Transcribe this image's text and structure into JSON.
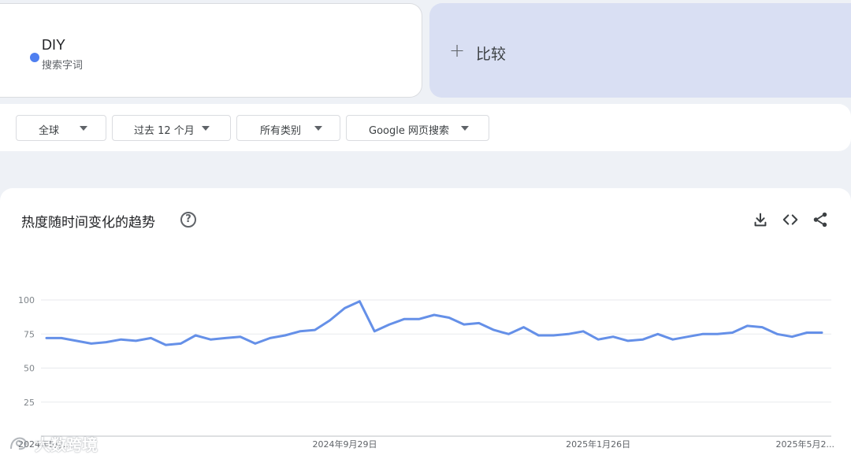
{
  "search_term": {
    "name": "DIY",
    "subtitle": "搜索字词",
    "color": "#4f7ff0"
  },
  "compare": {
    "plus_icon": "+",
    "label": "比较"
  },
  "filters": [
    {
      "label": "全球"
    },
    {
      "label": "过去 12 个月"
    },
    {
      "label": "所有类别"
    },
    {
      "label": "Google 网页搜索"
    }
  ],
  "chart_section": {
    "title": "热度随时间变化的趋势",
    "help_icon": "?",
    "tools": [
      "download-icon",
      "embed-icon",
      "share-icon"
    ]
  },
  "watermark": {
    "text": "大数跨境"
  },
  "chart_data": {
    "type": "line",
    "series": [
      {
        "name": "DIY",
        "color": "#6590e8",
        "values": [
          72,
          72,
          70,
          68,
          69,
          71,
          70,
          72,
          67,
          68,
          74,
          71,
          72,
          73,
          68,
          72,
          74,
          77,
          78,
          85,
          94,
          99,
          77,
          82,
          86,
          86,
          89,
          87,
          82,
          83,
          78,
          75,
          80,
          74,
          74,
          75,
          77,
          71,
          73,
          70,
          71,
          75,
          71,
          73,
          75,
          75,
          76,
          81,
          80,
          75,
          73,
          76,
          76
        ]
      }
    ],
    "ylim": [
      0,
      100
    ],
    "yticks": [
      "100",
      "75",
      "50",
      "25"
    ],
    "ytick_values": [
      100,
      75,
      50,
      25
    ],
    "xtick_labels": [
      "2024年5月...",
      "2024年9月29日",
      "2025年1月26日",
      "2025年5月2..."
    ],
    "xtick_indices": [
      0,
      20,
      37,
      52
    ],
    "grid": true
  }
}
